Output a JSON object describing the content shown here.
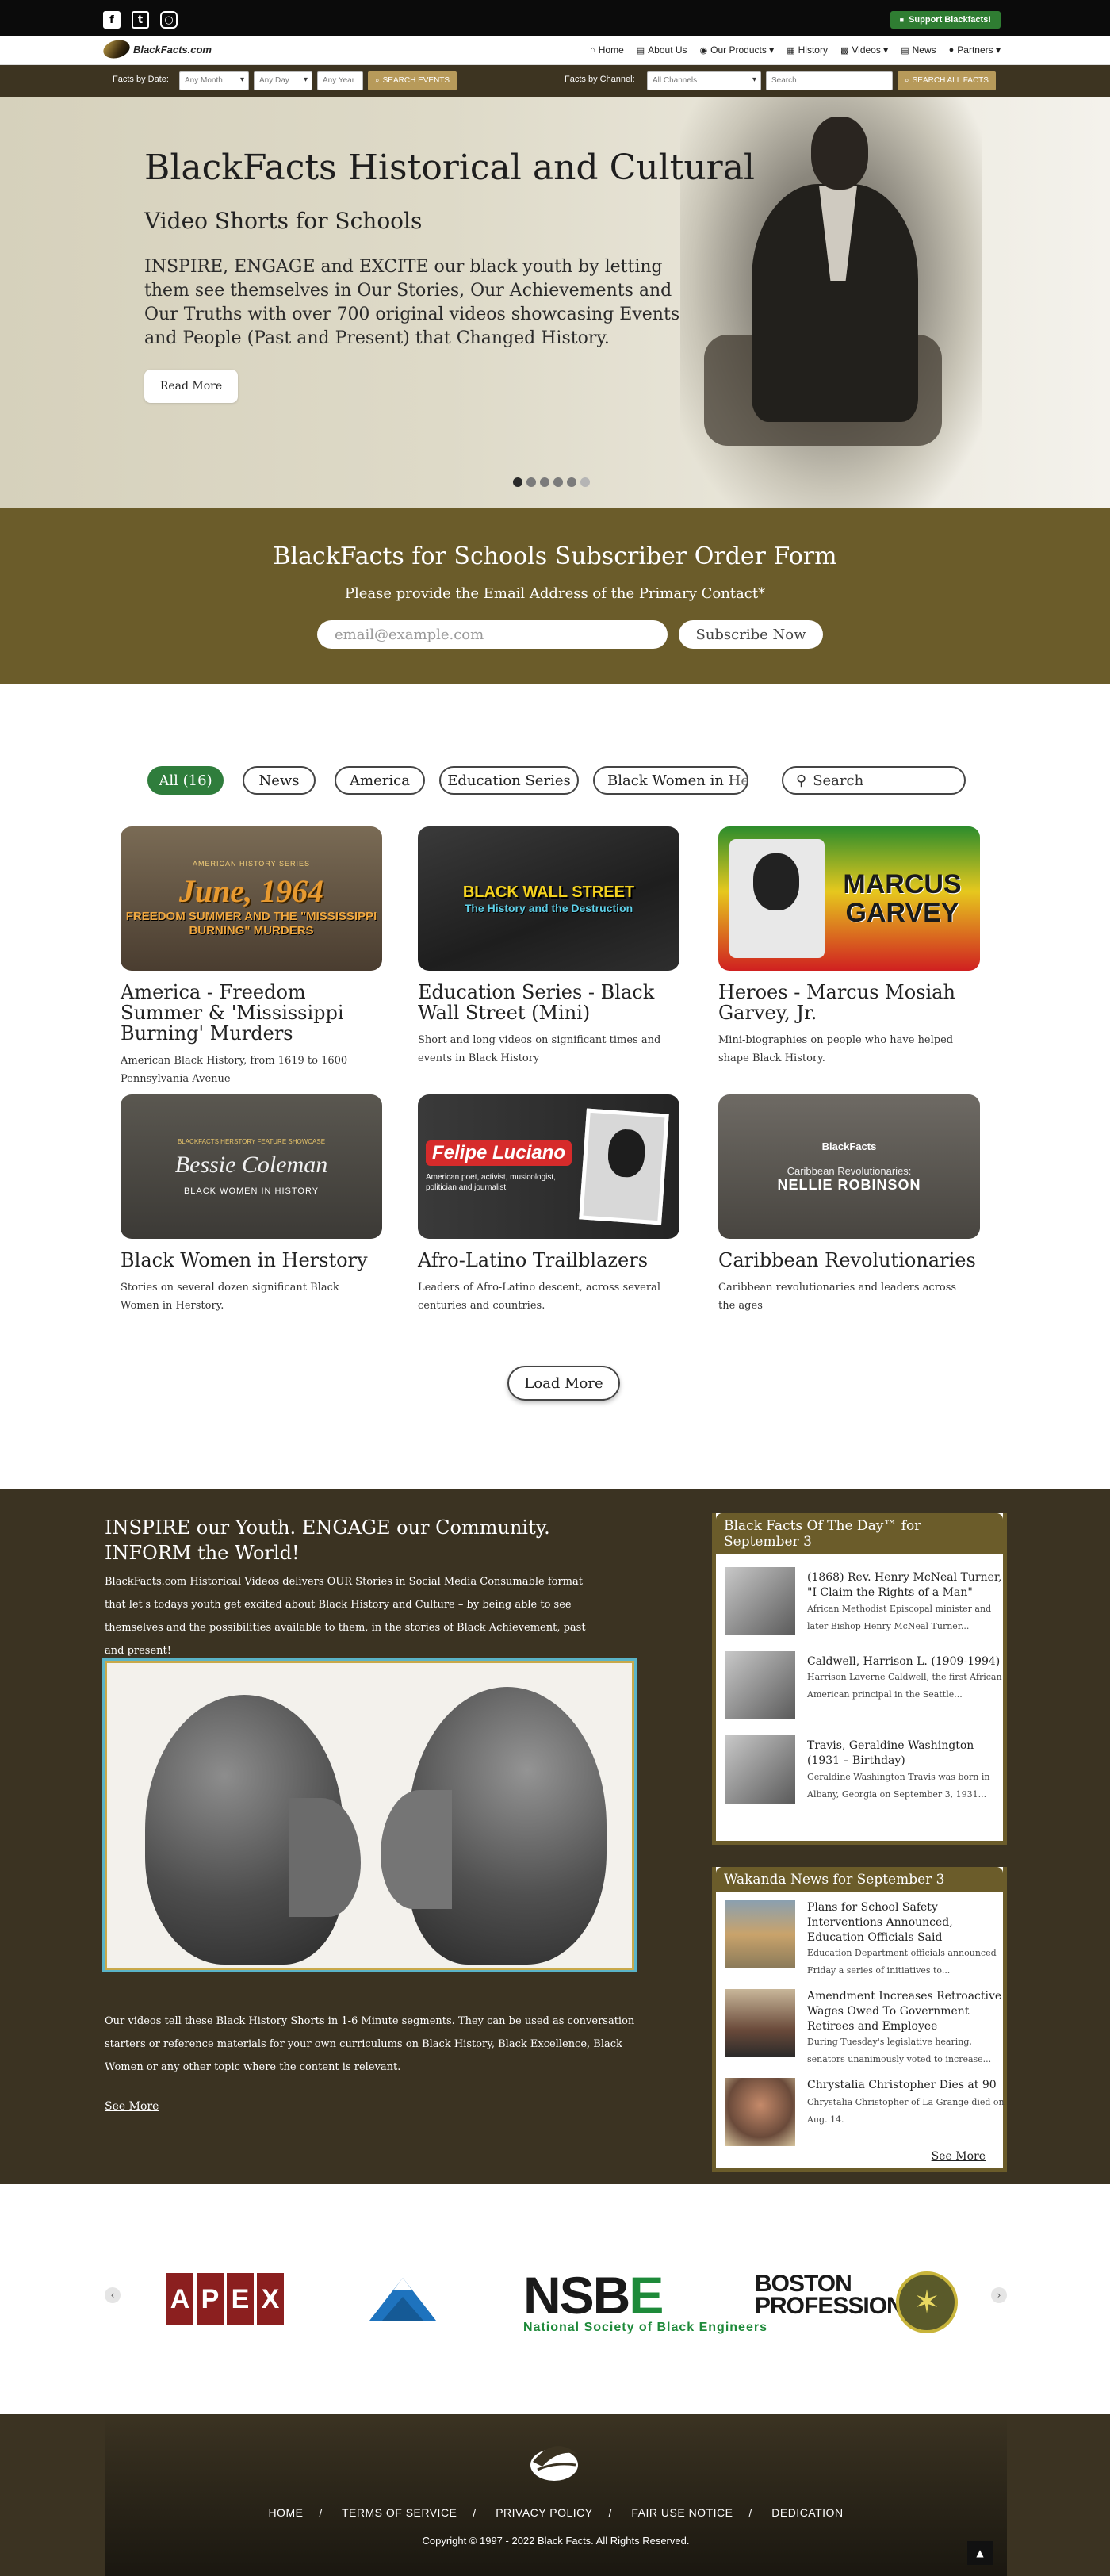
{
  "topbar": {
    "social": [
      "facebook-icon",
      "twitter-icon",
      "instagram-icon"
    ],
    "support_label": "Support Blackfacts!"
  },
  "nav": {
    "logo_text": "BlackFacts.com",
    "links": [
      {
        "icon": "home-icon",
        "label": "Home"
      },
      {
        "icon": "info-icon",
        "label": "About Us"
      },
      {
        "icon": "globe-icon",
        "label": "Our Products ▾"
      },
      {
        "icon": "calendar-icon",
        "label": "History"
      },
      {
        "icon": "video-icon",
        "label": "Videos ▾"
      },
      {
        "icon": "news-icon",
        "label": "News"
      },
      {
        "icon": "handshake-icon",
        "label": "Partners ▾"
      }
    ]
  },
  "filters": {
    "by_date_label": "Facts by Date:",
    "month_value": "Any Month",
    "day_value": "Any Day",
    "year_placeholder": "Any Year",
    "search_events_label": "SEARCH EVENTS",
    "by_channel_label": "Facts by Channel:",
    "channel_value": "All Channels",
    "search_placeholder": "Search",
    "search_all_label": "SEARCH ALL FACTS"
  },
  "hero": {
    "title": "BlackFacts Historical and Cultural",
    "subtitle": "Video Shorts for Schools",
    "body": "INSPIRE, ENGAGE and EXCITE our black youth by letting them see themselves in Our Stories, Our Achievements and Our Truths with over 700 original videos showcasing Events and People (Past and Present) that Changed History.",
    "read_more": "Read More",
    "slides": 6,
    "active_slide": 1
  },
  "order_form": {
    "title": "BlackFacts for Schools Subscriber Order Form",
    "subtitle": "Please provide the Email Address of the Primary Contact*",
    "email_placeholder": "email@example.com",
    "subscribe_label": "Subscribe Now"
  },
  "categories": {
    "chips": [
      "All (16)",
      "News",
      "America",
      "Education Series",
      "Black Women in Herstory"
    ],
    "active": "All (16)",
    "search_placeholder": "Search"
  },
  "videos": [
    {
      "title": "America - Freedom Summer & 'Mississippi Burning' Murders",
      "description": "American Black History, from 1619 to 1600 Pennsylvania Avenue",
      "thumb_header": "AMERICAN HISTORY SERIES",
      "thumb_big": "June, 1964",
      "thumb_small": "FREEDOM SUMMER AND THE \"MISSISSIPPI BURNING\" MURDERS"
    },
    {
      "title": "Education Series - Black Wall Street (Mini)",
      "description": "Short and long videos on significant times and events in Black History",
      "thumb_big": "BLACK WALL STREET",
      "thumb_small": "The History and the Destruction"
    },
    {
      "title": "Heroes - Marcus Mosiah Garvey, Jr.",
      "description": "Mini-biographies on people who have helped shape Black History.",
      "thumb_big": "MARCUS GARVEY"
    },
    {
      "title": "Black Women in Herstory",
      "description": "Stories on several dozen significant Black Women in Herstory.",
      "thumb_header": "BLACKFACTS HERSTORY FEATURE SHOWCASE",
      "thumb_big": "Bessie Coleman",
      "thumb_small": "BLACK WOMEN IN HISTORY"
    },
    {
      "title": "Afro-Latino Trailblazers",
      "description": "Leaders of Afro-Latino descent, across several centuries and countries.",
      "thumb_big": "Felipe Luciano",
      "thumb_small": "American poet, activist, musicologist, politician and journalist"
    },
    {
      "title": "Caribbean Revolutionaries",
      "description": "Caribbean revolutionaries and leaders across the ages",
      "thumb_header": "BlackFacts",
      "thumb_small": "Caribbean Revolutionaries:",
      "thumb_big": "NELLIE ROBINSON"
    }
  ],
  "load_more": "Load More",
  "info": {
    "heading_line1": "INSPIRE our Youth. ENGAGE our Community.",
    "heading_line2": "INFORM the World!",
    "para1": "BlackFacts.com Historical Videos delivers OUR Stories in Social Media Consumable format that let's todays youth get excited about Black History and Culture – by being able to see themselves and the possibilities available to them, in the stories of Black Achievement, past and present!",
    "para2": "Our videos tell these Black History Shorts in 1-6 Minute segments. They can be used as conversation starters or reference materials for your own curriculums on Black History, Black Excellence, Black Women or any other topic where the content is relevant.",
    "see_more": "See More"
  },
  "facts_of_day": {
    "title": "Black Facts Of The Day™ for September 3",
    "items": [
      {
        "title": "(1868) Rev. Henry McNeal Turner, \"I Claim the Rights of a Man\"",
        "desc": "African Methodist Episcopal minister and later Bishop Henry McNeal Turner..."
      },
      {
        "title": "Caldwell, Harrison L. (1909-1994)",
        "desc": "Harrison Laverne Caldwell, the first African American principal in the Seattle..."
      },
      {
        "title": "Travis, Geraldine Washington (1931 – Birthday)",
        "desc": "Geraldine Washington Travis was born in Albany, Georgia on September 3, 1931..."
      }
    ]
  },
  "wakanda_news": {
    "title": "Wakanda News for September 3",
    "items": [
      {
        "title": "Plans for School Safety Interventions Announced, Education Officials Said",
        "desc": "Education Department officials announced Friday a series of initiatives to..."
      },
      {
        "title": "Amendment Increases Retroactive Wages Owed To Government Retirees and Employee",
        "desc": "During Tuesday's legislative hearing, senators unanimously voted to increase..."
      },
      {
        "title": "Chrystalia Christopher Dies at 90",
        "desc": "Chrystalia Christopher of La Grange died on Aug. 14."
      }
    ],
    "see_more": "See More"
  },
  "partners": {
    "apex_letters": [
      "A",
      "P",
      "E",
      "X"
    ],
    "nsbe_main_a": "NSB",
    "nsbe_main_b": "E",
    "nsbe_line1": "BOSTON",
    "nsbe_line2": "PROFESSIONALS",
    "nsbe_tagline": "National Society of Black Engineers",
    "prev": "‹",
    "next": "›"
  },
  "footer": {
    "links": [
      "HOME",
      "TERMS OF SERVICE",
      "PRIVACY POLICY",
      "FAIR USE NOTICE",
      "DEDICATION"
    ],
    "copyright": "Copyright © 1997 - 2022 Black Facts. All Rights Reserved.",
    "to_top": "▲"
  },
  "colors": {
    "brown_dark": "#3b3322",
    "olive": "#6b5c2a",
    "green": "#2f7d32",
    "gold": "#b79a5a"
  }
}
